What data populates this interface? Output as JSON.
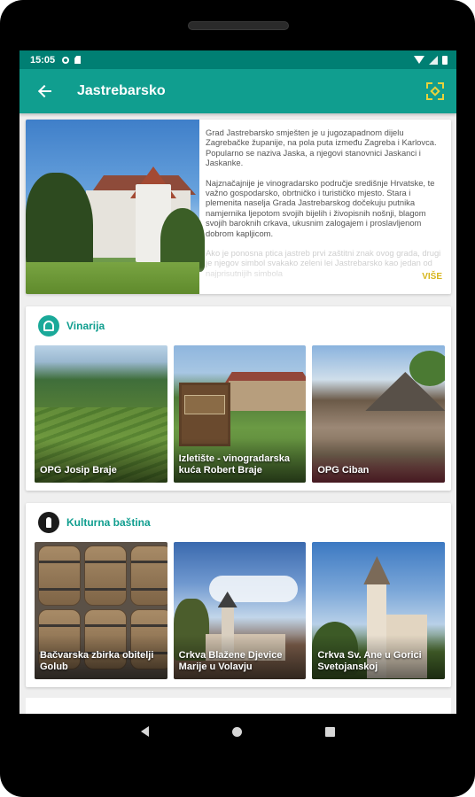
{
  "status_bar": {
    "time": "15:05",
    "icons": [
      "gear-icon",
      "sd-card-icon",
      "wifi-icon",
      "signal-icon",
      "battery-icon"
    ]
  },
  "app_bar": {
    "title": "Jastrebarsko",
    "back_icon": "arrow-left-icon",
    "action_icon": "ar-scan-icon",
    "action_color": "#e8d23b"
  },
  "intro": {
    "paragraphs": [
      "Grad Jastrebarsko smješten je u jugozapadnom dijelu Zagrebačke županije, na pola puta između Zagreba i Karlovca. Popularno se naziva Jaska, a njegovi stanovnici Jaskanci i Jaskanke.",
      "Najznačajnije je vinogradarsko područje središnje Hrvatske, te važno gospodarsko, obrtničko i turističko mjesto. Stara i plemenita naselja Grada Jastrebarskog dočekuju putnika namjernika ljepotom svojih bijelih i živopisnih nošnji, blagom svojih baroknih crkava, ukusnim zalogajem i prosla­vljenom dobrom kapljicom."
    ],
    "faded_paragraph": "Ako je ponosna ptica jastreb prvi zaštitni znak ovog grada, drugi je njegov simbol svakako zeleni lei­ Jastrebarsko kao jedan od najprisutnijih simbola",
    "more_label": "VIŠE"
  },
  "sections": [
    {
      "title": "Vinarija",
      "icon": "wine-grapes-icon",
      "cards": [
        {
          "label": "OPG Josip Braje"
        },
        {
          "label": "Izletište - vinogradarska kuća Robert Braje"
        },
        {
          "label": "OPG Ciban"
        }
      ]
    },
    {
      "title": "Kulturna baština",
      "icon": "heritage-bottle-icon",
      "cards": [
        {
          "label": "Bačvarska zbirka obitelji Golub"
        },
        {
          "label": "Crkva Blažene Djevice Marije u Volavju"
        },
        {
          "label": "Crkva Sv. Ane u Gorici Svetojanskoj"
        }
      ]
    }
  ],
  "colors": {
    "status_bar": "#007f73",
    "app_bar": "#109e8f",
    "section_title": "#109e8f",
    "more_link": "#d6b51b"
  }
}
